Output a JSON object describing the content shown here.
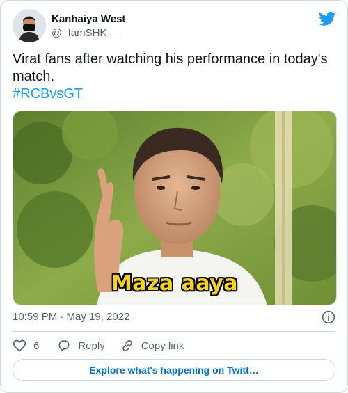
{
  "author": {
    "name": "Kanhaiya West",
    "handle": "@_IamSHK__"
  },
  "tweet": {
    "text": "Virat fans after watching his performance in today's match.",
    "hashtag": "#RCBvsGT"
  },
  "media": {
    "caption": "Maza aaya"
  },
  "meta": {
    "timestamp": "10:59 PM · May 19, 2022"
  },
  "actions": {
    "likes_count": "6",
    "reply_label": "Reply",
    "copy_link_label": "Copy link"
  },
  "explore": {
    "label": "Explore what's happening on Twitt…"
  },
  "icons": {
    "brand": "twitter-bird-icon",
    "info": "info-icon",
    "like": "heart-icon",
    "reply": "reply-icon",
    "copy": "link-icon"
  },
  "colors": {
    "brand": "#1d9bf0",
    "link": "#006fd6",
    "muted": "#536471",
    "caption": "#f5d21f"
  }
}
